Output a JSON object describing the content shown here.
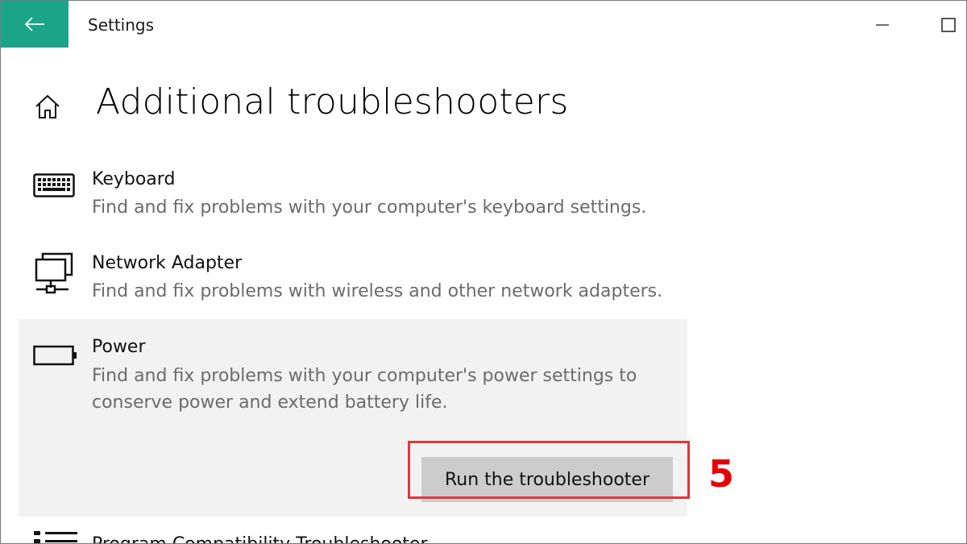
{
  "window": {
    "title": "Settings"
  },
  "page": {
    "title": "Additional troubleshooters"
  },
  "troubleshooters": [
    {
      "title": "Keyboard",
      "description": "Find and fix problems with your computer's keyboard settings.",
      "icon": "keyboard-icon"
    },
    {
      "title": "Network Adapter",
      "description": "Find and fix problems with wireless and other network adapters.",
      "icon": "network-adapter-icon"
    },
    {
      "title": "Power",
      "description": "Find and fix problems with your computer's power settings to conserve power and extend battery life.",
      "icon": "battery-icon",
      "button_label": "Run the troubleshooter"
    },
    {
      "title": "Program Compatibility Troubleshooter",
      "icon": "program-list-icon"
    }
  ],
  "annotation": {
    "step": "5",
    "color": "#e60000"
  },
  "colors": {
    "accent": "#1aa589",
    "selected_background": "#f2f2f2",
    "button_background": "#cccccc",
    "highlight_border": "#d93a3a"
  }
}
